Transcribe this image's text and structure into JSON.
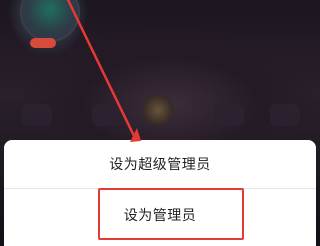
{
  "menu": {
    "set_super_admin": "设为超级管理员",
    "set_admin": "设为管理员"
  },
  "annotation": {
    "color": "#e53935"
  }
}
